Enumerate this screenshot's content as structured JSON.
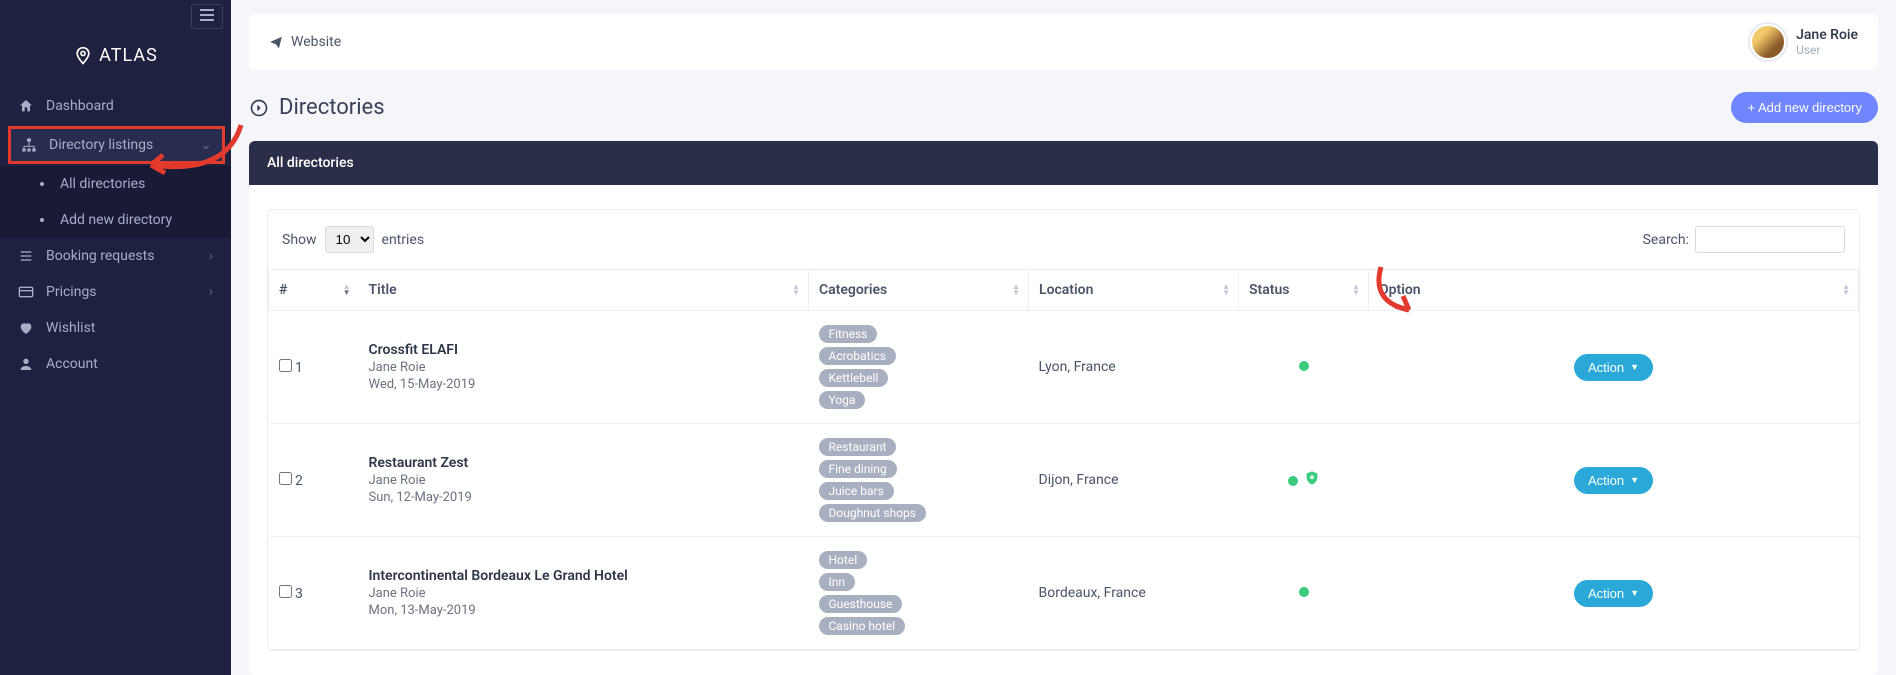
{
  "brand": "ATLAS",
  "topbar": {
    "website_label": "Website"
  },
  "profile": {
    "name": "Jane Roie",
    "role": "User"
  },
  "sidebar": {
    "items": {
      "dashboard": "Dashboard",
      "directory_listings": "Directory listings",
      "booking_requests": "Booking requests",
      "pricings": "Pricings",
      "wishlist": "Wishlist",
      "account": "Account"
    },
    "sub": {
      "all_directories": "All directories",
      "add_new_directory": "Add new directory"
    }
  },
  "page": {
    "title": "Directories",
    "add_button": "+ Add new directory",
    "card_header": "All directories"
  },
  "table": {
    "show_label": "Show",
    "entries_label": "entries",
    "page_size": "10",
    "search_label": "Search:",
    "headers": {
      "num": "#",
      "title": "Title",
      "categories": "Categories",
      "location": "Location",
      "status": "Status",
      "option": "Option"
    },
    "action_label": "Action",
    "rows": [
      {
        "num": "1",
        "title": "Crossfit ELAFI",
        "user": "Jane Roie",
        "date": "Wed, 15-May-2019",
        "categories": [
          "Fitness",
          "Acrobatics",
          "Kettlebell",
          "Yoga"
        ],
        "location": "Lyon, France",
        "status": "active",
        "featured": false
      },
      {
        "num": "2",
        "title": "Restaurant Zest",
        "user": "Jane Roie",
        "date": "Sun, 12-May-2019",
        "categories": [
          "Restaurant",
          "Fine dining",
          "Juice bars",
          "Doughnut shops"
        ],
        "location": "Dijon, France",
        "status": "active",
        "featured": true
      },
      {
        "num": "3",
        "title": "Intercontinental Bordeaux Le Grand Hotel",
        "user": "Jane Roie",
        "date": "Mon, 13-May-2019",
        "categories": [
          "Hotel",
          "Inn",
          "Guesthouse",
          "Casino hotel"
        ],
        "location": "Bordeaux, France",
        "status": "active",
        "featured": false
      }
    ]
  }
}
